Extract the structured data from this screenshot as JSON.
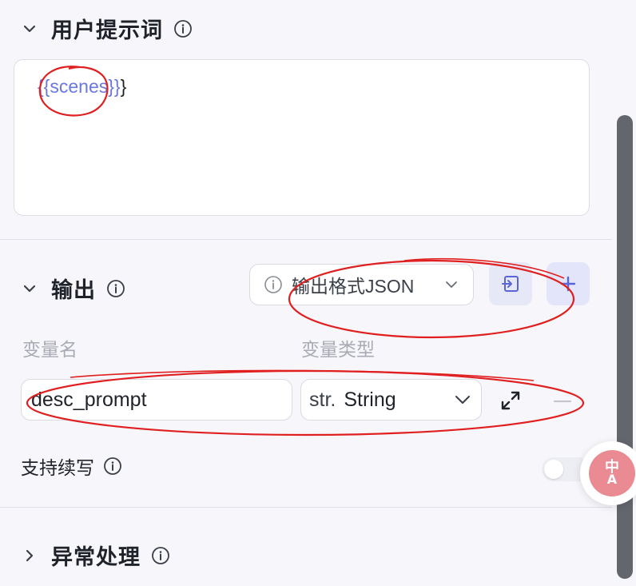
{
  "user_prompt": {
    "title": "用户提示词",
    "content_var": "{{scenes}}",
    "content_tail": "}"
  },
  "output": {
    "title": "输出",
    "format_label": "输出格式JSON",
    "col_var_name": "变量名",
    "col_var_type": "变量类型",
    "variable": {
      "name": "desc_prompt",
      "type_prefix": "str.",
      "type": "String"
    },
    "continue_label": "支持续写",
    "continue_enabled": false
  },
  "error_handling": {
    "title": "异常处理"
  },
  "translate_fab": {
    "glyph_top": "中",
    "glyph_bottom": "A"
  },
  "colors": {
    "accent": "#6b78e0",
    "annotation": "#e02020",
    "fab": "#ea8a93"
  }
}
